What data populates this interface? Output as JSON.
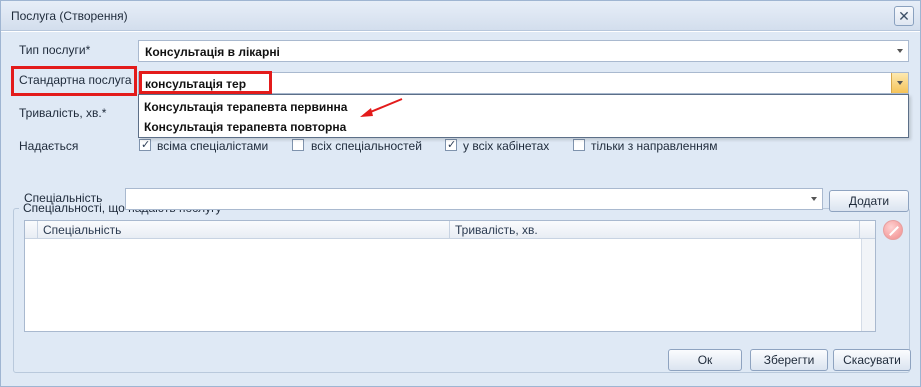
{
  "window": {
    "title": "Послуга (Створення)",
    "close_glyph": "✕"
  },
  "form": {
    "service_type": {
      "label": "Тип послуги*",
      "value": "Консультація в лікарні"
    },
    "standard_service": {
      "label": "Стандартна послуга",
      "value": "консультація тер"
    },
    "duration": {
      "label": "Тривалість, хв.*"
    },
    "provided": {
      "label": "Надається"
    },
    "dropdown_items": [
      "Консультація терапевта первинна",
      "Консультація терапевта повторна"
    ],
    "checkboxes": [
      {
        "label": "всіма спеціалістами",
        "checked": true
      },
      {
        "label": "всіх спеціальностей",
        "checked": false
      },
      {
        "label": "у всіх кабінетах",
        "checked": true
      },
      {
        "label": "тільки з направленням",
        "checked": false
      }
    ]
  },
  "specialties": {
    "group_title": "Спеціальності, що надають послугу",
    "field_label": "Спеціальність",
    "add_button": "Додати",
    "columns": [
      "Спеціальність",
      "Тривалість, хв."
    ]
  },
  "footer": {
    "ok": "Ок",
    "save": "Зберегти",
    "cancel": "Скасувати"
  },
  "colors": {
    "highlight": "#e31b1b",
    "window_bg": "#dfe9f5",
    "accent_button": "#f5c35a"
  }
}
